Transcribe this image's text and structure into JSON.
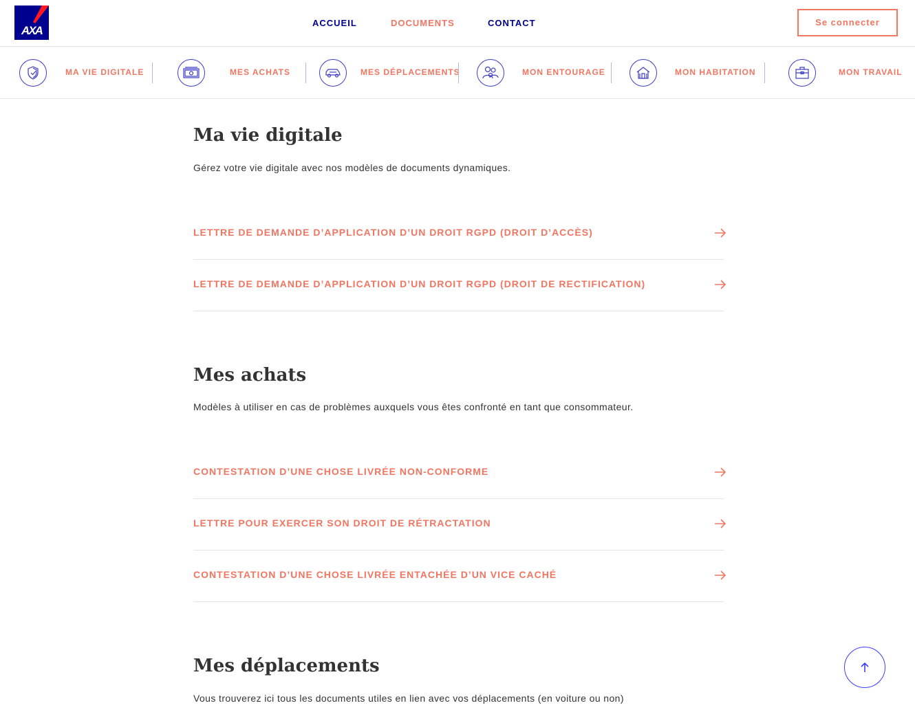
{
  "header": {
    "logo_text": "AXA",
    "nav": [
      "Accueil",
      "Documents",
      "Contact"
    ],
    "login_label": "Se connecter"
  },
  "categories": [
    {
      "label": "Ma vie digitale",
      "icon": "shield-icon"
    },
    {
      "label": "Mes achats",
      "icon": "money-icon"
    },
    {
      "label": "Mes déplacements",
      "icon": "car-icon"
    },
    {
      "label": "Mon entourage",
      "icon": "people-icon"
    },
    {
      "label": "Mon habitation",
      "icon": "house-icon"
    },
    {
      "label": "Mon travail",
      "icon": "briefcase-icon"
    }
  ],
  "sections": [
    {
      "title": "Ma vie digitale",
      "description": "Gérez votre vie digitale avec nos modèles de documents dynamiques.",
      "documents": [
        "Lettre de demande d’application d’un droit RGPD (droit d’accès)",
        "Lettre de demande d’application d’un droit RGPD (droit de rectification)"
      ]
    },
    {
      "title": "Mes achats",
      "description": "Modèles à utiliser en cas de problèmes auxquels vous êtes confronté en tant que consommateur.",
      "documents": [
        "Contestation d’une chose livrée non-conforme",
        "Lettre pour exercer son droit de rétractation",
        "Contestation d’une chose livrée entachée d’un vice caché"
      ]
    },
    {
      "title": "Mes déplacements",
      "description": "Vous trouverez ici tous les documents utiles en lien avec vos déplacements (en voiture ou non)"
    }
  ],
  "colors": {
    "brand_blue": "#00008f",
    "accent_coral": "#f07662",
    "icon_blue": "#3d3dc4"
  },
  "scroll_top_icon": "arrow-up-icon"
}
